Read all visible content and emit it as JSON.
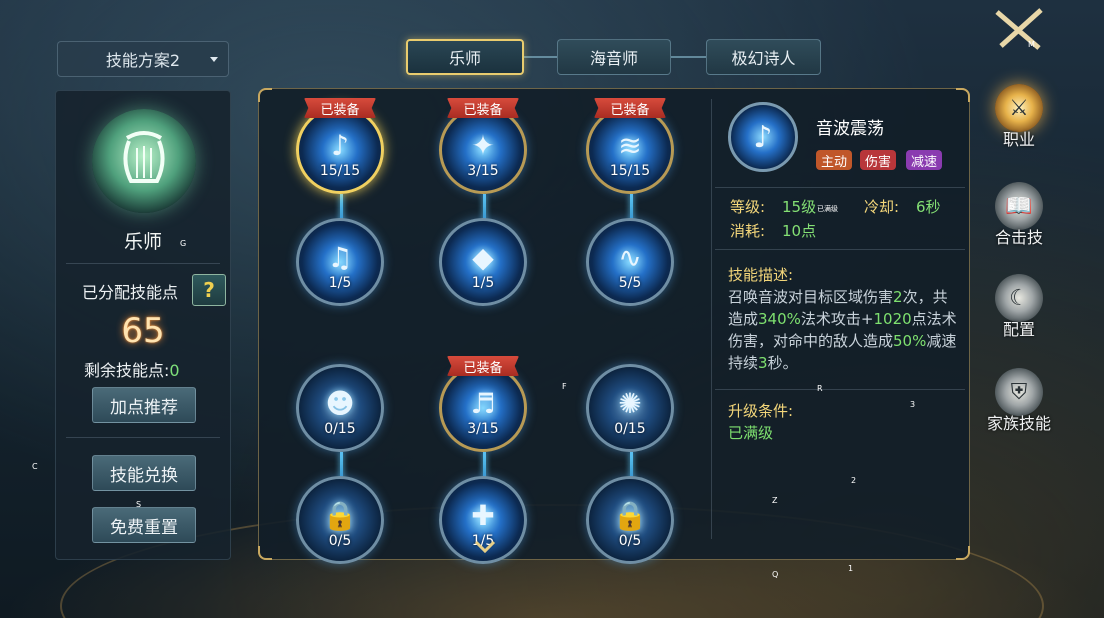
{
  "scheme": {
    "label": "技能方案2"
  },
  "left_panel": {
    "class_name": "乐师",
    "key_g": "G",
    "allocated_label": "已分配技能点",
    "help_label": "?",
    "points_value": "65",
    "remaining_label": "剩余技能点:",
    "remaining_value": "0",
    "recommend_label": "加点推荐",
    "exchange_label": "技能兑换",
    "reset_label": "免费重置"
  },
  "tabs": [
    {
      "label": "乐师",
      "active": true
    },
    {
      "label": "海音师",
      "active": false
    },
    {
      "label": "极幻诗人",
      "active": false
    }
  ],
  "equipped_badge": "已装备",
  "skills": [
    {
      "id": "s1",
      "level": "15/15",
      "equipped": true,
      "selected": true,
      "glyph": "♪"
    },
    {
      "id": "s2",
      "level": "3/15",
      "equipped": true,
      "selected": false,
      "glyph": "✦"
    },
    {
      "id": "s3",
      "level": "15/15",
      "equipped": true,
      "selected": false,
      "glyph": "≋"
    },
    {
      "id": "s4",
      "level": "1/5",
      "equipped": false,
      "selected": false,
      "glyph": "♫"
    },
    {
      "id": "s5",
      "level": "1/5",
      "equipped": false,
      "selected": false,
      "glyph": "◆"
    },
    {
      "id": "s6",
      "level": "5/5",
      "equipped": false,
      "selected": false,
      "glyph": "∿"
    },
    {
      "id": "s7",
      "level": "0/15",
      "equipped": false,
      "selected": false,
      "glyph": "☻"
    },
    {
      "id": "s8",
      "level": "3/15",
      "equipped": true,
      "selected": false,
      "glyph": "♬"
    },
    {
      "id": "s9",
      "level": "0/15",
      "equipped": false,
      "selected": false,
      "glyph": "✺"
    },
    {
      "id": "s10",
      "level": "0/5",
      "equipped": false,
      "selected": false,
      "glyph": "🔒"
    },
    {
      "id": "s11",
      "level": "1/5",
      "equipped": false,
      "selected": false,
      "glyph": "✚"
    },
    {
      "id": "s12",
      "level": "0/5",
      "equipped": false,
      "selected": false,
      "glyph": "🔒"
    }
  ],
  "detail": {
    "name": "音波震荡",
    "tags": [
      {
        "label": "主动",
        "color": "#c0572a"
      },
      {
        "label": "伤害",
        "color": "#b8363a"
      },
      {
        "label": "减速",
        "color": "#8a3bb0"
      }
    ],
    "level_label": "等级:",
    "level_value": "15级",
    "level_tiny": "已满级",
    "cooldown_label": "冷却:",
    "cooldown_value": "6秒",
    "cost_label": "消耗:",
    "cost_value": "10点",
    "desc_title": "技能描述:",
    "desc": {
      "p1": "召唤音波对目标区域伤害",
      "n1": "2",
      "p2": "次，共造成",
      "n2": "340%",
      "p3": "法术攻击+",
      "n3": "1020",
      "p4": "点法术伤害，对命中的敌人造成",
      "n4": "50%",
      "p5": "减速持续",
      "n5": "3",
      "p6": "秒。"
    },
    "upgrade_title": "升级条件:",
    "upgrade_value": "已满级"
  },
  "nav": [
    {
      "label": "职业",
      "active": true,
      "key": ""
    },
    {
      "label": "合击技",
      "active": false,
      "key": "B"
    },
    {
      "label": "配置",
      "active": false,
      "key": ""
    },
    {
      "label": "家族技能",
      "active": false,
      "key": ""
    }
  ],
  "top_icon_key": "M",
  "key_hints": {
    "c": "C",
    "f": "F",
    "r": "R",
    "three": "3",
    "two": "2",
    "z": "Z",
    "one": "1",
    "q": "Q",
    "s": "S"
  }
}
